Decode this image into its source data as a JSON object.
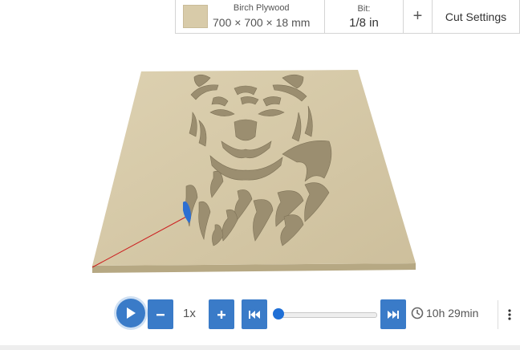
{
  "toolbar": {
    "material_name": "Birch Plywood",
    "material_dims": "700 × 700 × 18 mm",
    "bit_label": "Bit:",
    "bit_value": "1/8 in",
    "add_label": "+",
    "cut_settings_label": "Cut Settings"
  },
  "playback": {
    "speed_label": "1x",
    "progress": 0.0,
    "estimated_time": "10h 29min"
  },
  "colors": {
    "button_blue": "#3a7bc8",
    "board_face": "#d8cba9",
    "board_carved": "#9b8e70",
    "toolpath_red": "#cc2020",
    "cut_position_blue": "#2d6fd2"
  },
  "icons": {
    "play": "play-icon",
    "minus": "minus-icon",
    "plus": "plus-icon",
    "rewind": "skip-back-icon",
    "forward": "skip-forward-icon",
    "clock": "clock-icon",
    "more": "vertical-ellipsis-icon"
  }
}
